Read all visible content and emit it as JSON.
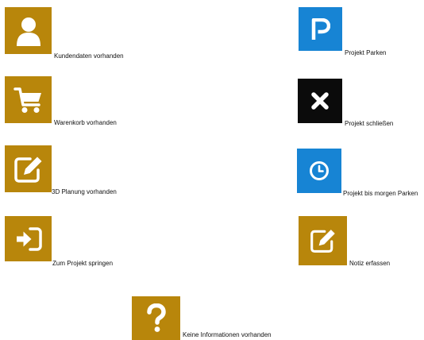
{
  "colors": {
    "gold": "#b8860b",
    "blue": "#1784d4",
    "black": "#0b0b0b"
  },
  "items": [
    {
      "label": "Kundendaten vorhanden",
      "icon": "user-icon",
      "color": "gold"
    },
    {
      "label": "Projekt Parken",
      "icon": "parking-icon",
      "color": "blue"
    },
    {
      "label": "Warenkorb vorhanden",
      "icon": "shopping-cart-icon",
      "color": "gold"
    },
    {
      "label": "Projekt schließen",
      "icon": "close-icon",
      "color": "black"
    },
    {
      "label": "3D Planung vorhanden",
      "icon": "edit-icon",
      "color": "gold"
    },
    {
      "label": "Projekt bis morgen Parken",
      "icon": "clock-icon",
      "color": "blue"
    },
    {
      "label": "Zum Projekt springen",
      "icon": "sign-in-icon",
      "color": "gold"
    },
    {
      "label": "Notiz erfassen",
      "icon": "note-edit-icon",
      "color": "gold"
    },
    {
      "label": "Keine Informationen vorhanden",
      "icon": "question-icon",
      "color": "gold"
    }
  ]
}
